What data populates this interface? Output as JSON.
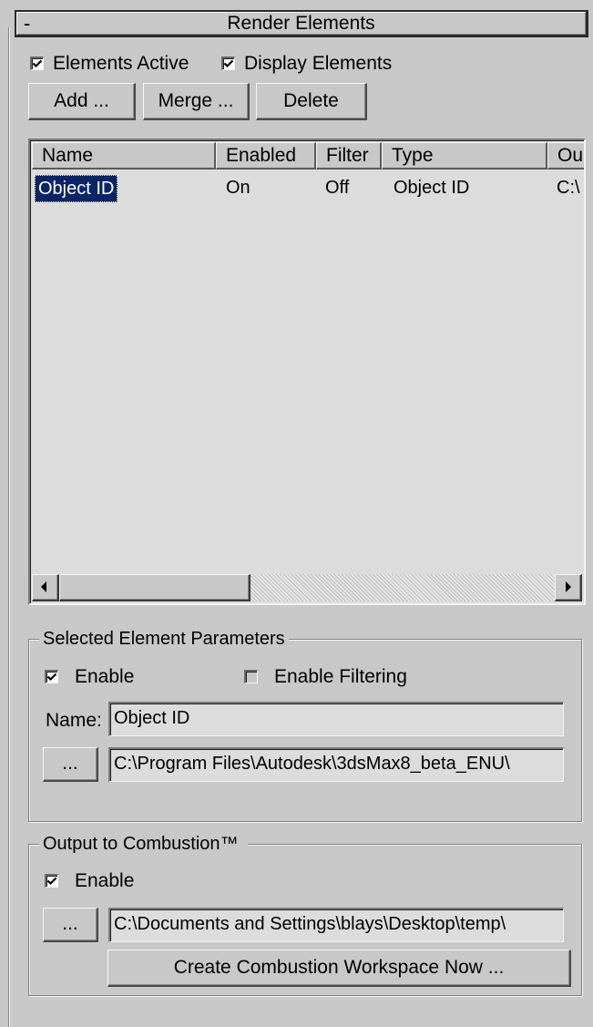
{
  "rollout": {
    "collapse_symbol": "-",
    "title": "Render Elements"
  },
  "top_checks": {
    "elements_active": {
      "label": "Elements Active",
      "checked": true
    },
    "display_elements": {
      "label": "Display Elements",
      "checked": true
    }
  },
  "buttons": {
    "add": "Add ...",
    "merge": "Merge ...",
    "delete": "Delete"
  },
  "list": {
    "columns": [
      "Name",
      "Enabled",
      "Filter",
      "Type",
      "Ou"
    ],
    "rows": [
      {
        "name": "Object ID",
        "enabled": "On",
        "filter": "Off",
        "type": "Object ID",
        "output": "C:\\"
      }
    ]
  },
  "selected_params": {
    "legend": "Selected Element Parameters",
    "enable": {
      "label": "Enable",
      "checked": true
    },
    "enable_filtering": {
      "label": "Enable Filtering",
      "checked": false
    },
    "name_label": "Name:",
    "name_value": "Object ID",
    "browse_label": "...",
    "path_value": "C:\\Program Files\\Autodesk\\3dsMax8_beta_ENU\\"
  },
  "combustion": {
    "legend": "Output to Combustion™",
    "enable": {
      "label": "Enable",
      "checked": true
    },
    "browse_label": "...",
    "path_value": "C:\\Documents and Settings\\blays\\Desktop\\temp\\",
    "create_button": "Create Combustion Workspace Now ..."
  },
  "icons": [
    "checkmark-icon",
    "scroll-left-arrow-icon",
    "scroll-right-arrow-icon"
  ]
}
